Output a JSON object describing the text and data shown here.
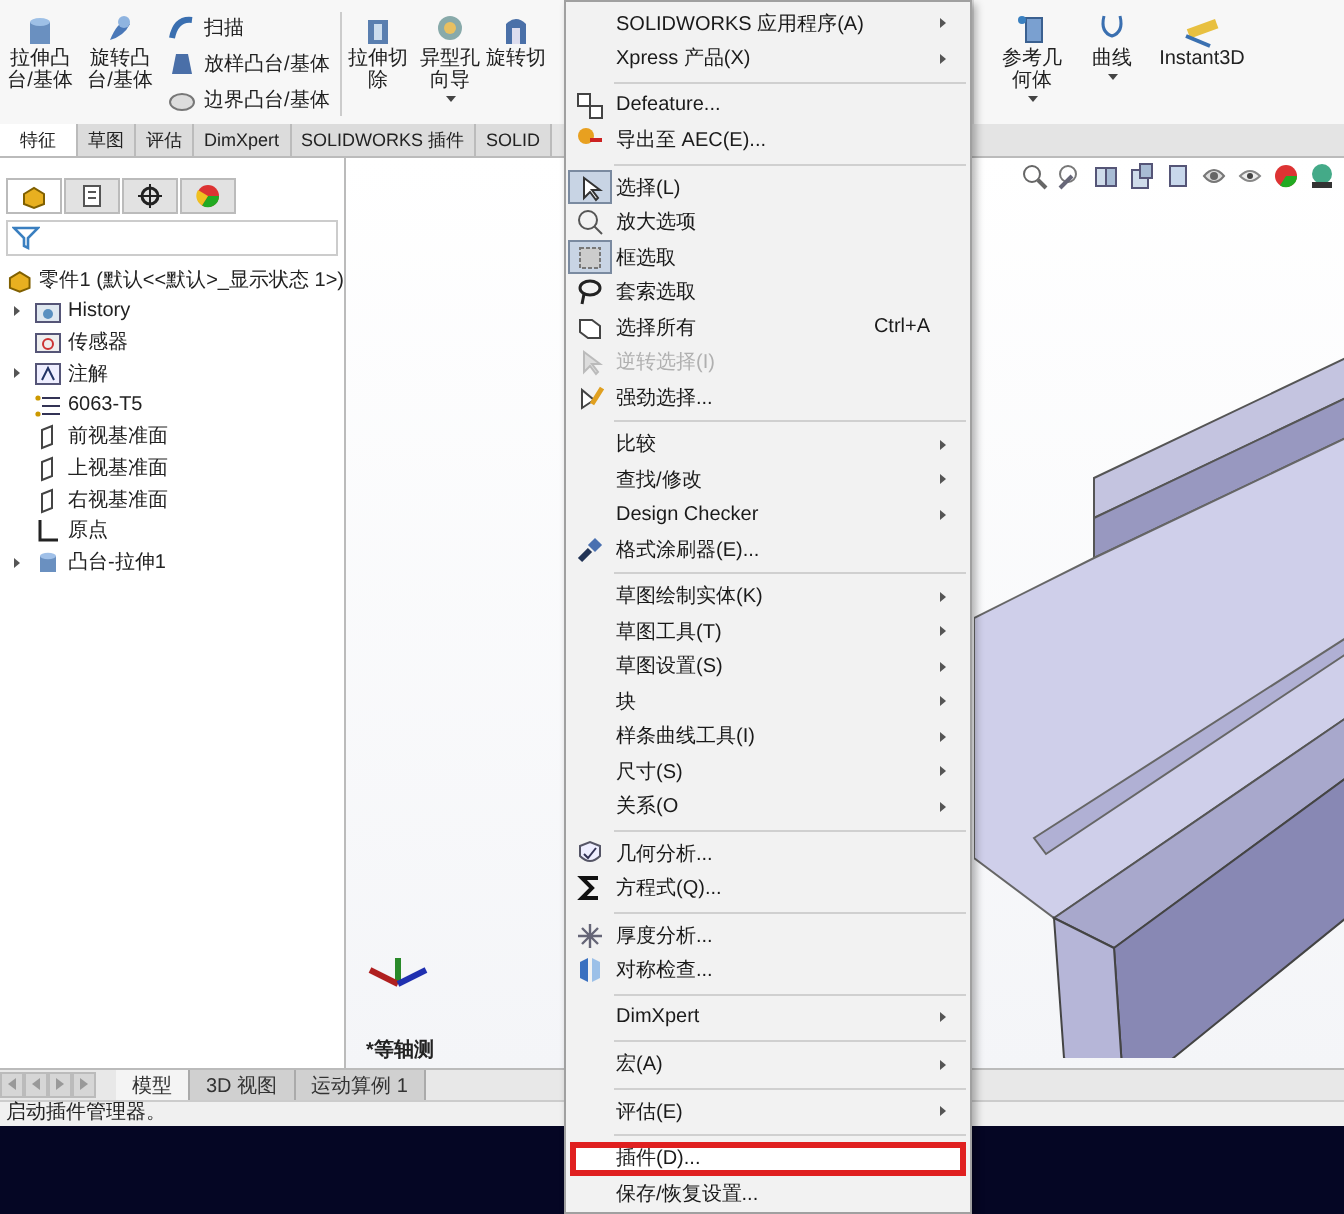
{
  "toolbar": {
    "large_buttons": [
      {
        "label": "拉伸凸台/基体"
      },
      {
        "label": "旋转凸台/基体"
      }
    ],
    "small_buttons": [
      {
        "label": "扫描"
      },
      {
        "label": "放样凸台/基体"
      },
      {
        "label": "边界凸台/基体"
      }
    ],
    "cut_buttons": [
      {
        "label": "拉伸切除",
        "dropdown": false
      },
      {
        "label": "异型孔向导",
        "dropdown": true
      },
      {
        "label": "旋转切",
        "dropdown": false
      }
    ],
    "right_buttons": [
      {
        "label": "参考几何体",
        "dropdown": true
      },
      {
        "label": "曲线",
        "dropdown": true
      },
      {
        "label": "Instant3D",
        "dropdown": false
      }
    ]
  },
  "tabs": [
    {
      "label": "特征",
      "selected": true
    },
    {
      "label": "草图",
      "selected": false
    },
    {
      "label": "评估",
      "selected": false
    },
    {
      "label": "DimXpert",
      "selected": false
    },
    {
      "label": "SOLIDWORKS 插件",
      "selected": false
    },
    {
      "label": "SOLID",
      "selected": false
    }
  ],
  "panel_tabs": [
    {
      "selected": true
    },
    {
      "selected": false
    },
    {
      "selected": false
    },
    {
      "selected": false
    }
  ],
  "tree": {
    "label": "零件1  (默认<<默认>_显示状态 1>)",
    "children": [
      {
        "label": "History",
        "expanded": false
      },
      {
        "label": "传感器"
      },
      {
        "label": "注解",
        "expanded": false
      },
      {
        "label": "6063-T5"
      },
      {
        "label": "前视基准面"
      },
      {
        "label": "上视基准面"
      },
      {
        "label": "右视基准面"
      },
      {
        "label": "原点"
      },
      {
        "label": "凸台-拉伸1",
        "expanded": false
      }
    ]
  },
  "view_label": "*等轴测",
  "bottom_tabs": [
    {
      "label": "模型",
      "selected": true
    },
    {
      "label": "3D 视图",
      "selected": false
    },
    {
      "label": "运动算例 1",
      "selected": false
    }
  ],
  "status_bar": "启动插件管理器。",
  "context_menu": {
    "sections": [
      [
        {
          "label": "SOLIDWORKS 应用程序(A)",
          "submenu": true,
          "disabled": false,
          "highlighted": false
        },
        {
          "label": "Xpress 产品(X)",
          "submenu": true,
          "disabled": false,
          "highlighted": false
        }
      ],
      [
        {
          "label": "Defeature...",
          "submenu": false,
          "disabled": false,
          "highlighted": false
        },
        {
          "label": "导出至 AEC(E)...",
          "submenu": false,
          "disabled": false,
          "highlighted": false
        }
      ],
      [
        {
          "label": "选择(L)",
          "submenu": false,
          "disabled": false,
          "highlighted": false,
          "checked": true
        },
        {
          "label": "放大选项",
          "submenu": false,
          "disabled": false,
          "highlighted": false,
          "checked": false
        },
        {
          "label": "框选取",
          "submenu": false,
          "disabled": false,
          "highlighted": false,
          "checked": true
        },
        {
          "label": "套索选取",
          "submenu": false,
          "disabled": false,
          "highlighted": false,
          "checked": false
        },
        {
          "label": "选择所有",
          "shortcut": "Ctrl+A",
          "submenu": false,
          "disabled": false,
          "highlighted": false,
          "checked": false
        },
        {
          "label": "逆转选择(I)",
          "submenu": false,
          "disabled": true,
          "highlighted": false,
          "checked": false
        },
        {
          "label": "强劲选择...",
          "submenu": false,
          "disabled": false,
          "highlighted": false,
          "checked": false
        }
      ],
      [
        {
          "label": "比较",
          "submenu": true,
          "disabled": false,
          "highlighted": false
        },
        {
          "label": "查找/修改",
          "submenu": true,
          "disabled": false,
          "highlighted": false
        },
        {
          "label": "Design Checker",
          "submenu": true,
          "disabled": false,
          "highlighted": false
        },
        {
          "label": "格式涂刷器(E)...",
          "submenu": false,
          "disabled": false,
          "highlighted": false
        }
      ],
      [
        {
          "label": "草图绘制实体(K)",
          "submenu": true,
          "disabled": false,
          "highlighted": false
        },
        {
          "label": "草图工具(T)",
          "submenu": true,
          "disabled": false,
          "highlighted": false
        },
        {
          "label": "草图设置(S)",
          "submenu": true,
          "disabled": false,
          "highlighted": false
        },
        {
          "label": "块",
          "submenu": true,
          "disabled": false,
          "highlighted": false
        },
        {
          "label": "样条曲线工具(I)",
          "submenu": true,
          "disabled": false,
          "highlighted": false
        },
        {
          "label": "尺寸(S)",
          "submenu": true,
          "disabled": false,
          "highlighted": false
        },
        {
          "label": "关系(O",
          "submenu": true,
          "disabled": false,
          "highlighted": false
        }
      ],
      [
        {
          "label": "几何分析...",
          "submenu": false,
          "disabled": false,
          "highlighted": false
        },
        {
          "label": "方程式(Q)...",
          "submenu": false,
          "disabled": false,
          "highlighted": false
        }
      ],
      [
        {
          "label": "厚度分析...",
          "submenu": false,
          "disabled": false,
          "highlighted": false
        },
        {
          "label": "对称检查...",
          "submenu": false,
          "disabled": false,
          "highlighted": false
        }
      ],
      [
        {
          "label": "DimXpert",
          "submenu": true,
          "disabled": false,
          "highlighted": false
        }
      ],
      [
        {
          "label": "宏(A)",
          "submenu": true,
          "disabled": false,
          "highlighted": false
        }
      ],
      [
        {
          "label": "评估(E)",
          "submenu": true,
          "disabled": false,
          "highlighted": false
        }
      ],
      [
        {
          "label": "插件(D)...",
          "submenu": false,
          "disabled": false,
          "highlighted": true
        },
        {
          "label": "保存/恢复设置...",
          "submenu": false,
          "disabled": false,
          "highlighted": false
        }
      ]
    ]
  }
}
